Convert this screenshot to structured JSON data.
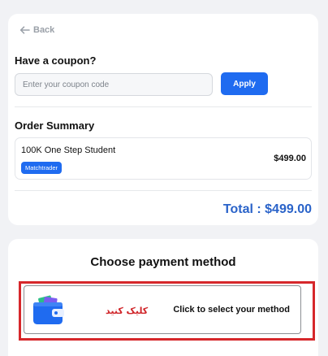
{
  "nav": {
    "back_label": "Back"
  },
  "coupon": {
    "title": "Have a coupon?",
    "placeholder": "Enter your coupon code",
    "apply_label": "Apply"
  },
  "order_summary": {
    "title": "Order Summary",
    "item": {
      "name": "100K One Step Student",
      "badge": "Matchtrader",
      "price": "$499.00"
    },
    "total": "Total : $499.00"
  },
  "payment": {
    "title": "Choose payment method",
    "annotation": "کلیک کنید",
    "select_label": "Click to select your method"
  },
  "colors": {
    "accent": "#1f6bf0",
    "total_text": "#2a63c9",
    "highlight_border": "#d6272b",
    "background": "#f1f2f5"
  },
  "icons": {
    "back": "arrow-left-icon",
    "wallet": "wallet-icon"
  }
}
